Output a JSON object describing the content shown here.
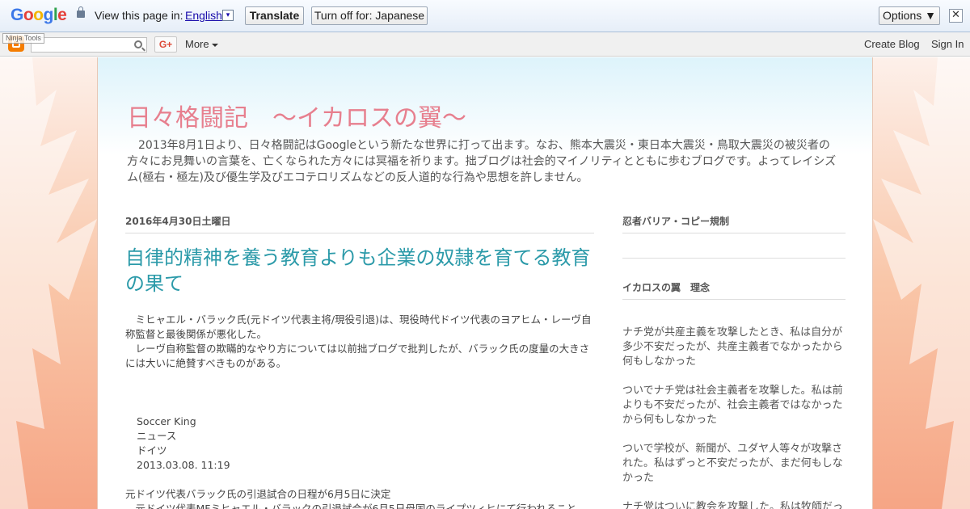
{
  "translate_bar": {
    "logo": "Google",
    "prompt": "View this page in:",
    "language": "English",
    "dropdown_glyph": "▾",
    "translate_label": "Translate",
    "turn_off_label": "Turn off for: Japanese",
    "options_label": "Options ▼",
    "close_glyph": "✕"
  },
  "navbar": {
    "ninja_label": "Ninja Tools",
    "search_placeholder": "",
    "gplus_label": "G+",
    "more_label": "More",
    "create_blog": "Create Blog",
    "sign_in": "Sign In"
  },
  "blog": {
    "title": "日々格闘記　～イカロスの翼～",
    "description": "　2013年8月1日より、日々格闘記はGoogleという新たな世界に打って出ます。なお、熊本大震災・東日本大震災・鳥取大震災の被災者の方々にお見舞いの言葉を、亡くなられた方々には冥福を祈ります。拙ブログは社会的マイノリティとともに歩むブログです。よってレイシズム(極右・極左)及び優生学及びエコテロリズムなどの反人道的な行為や思想を許しません。"
  },
  "post": {
    "date": "2016年4月30日土曜日",
    "title": "自律的精神を養う教育よりも企業の奴隷を育てる教育の果て",
    "para1": "　ミヒャエル・バラック氏(元ドイツ代表主将/現役引退)は、現役時代ドイツ代表のヨアヒム・レーヴ自称監督と最後関係が悪化した。",
    "para2": "　レーヴ自称監督の欺瞞的なやり方については以前拙ブログで批判したが、バラック氏の度量の大きさには大いに絶賛すべきものがある。",
    "source_lines": [
      "Soccer King",
      "ニュース",
      "ドイツ",
      "2013.03.08. 11:19"
    ],
    "headline": "元ドイツ代表バラック氏の引退試合の日程が6月5日に決定",
    "cut_line": "　元ドイツ代表MFミヒャエル・バラックの引退試合が6月5日母国のライプツィヒにて行われること"
  },
  "sidebar": {
    "widget1_title": "忍者バリア・コピー規制",
    "widget2_title": "イカロスの翼　理念",
    "paragraphs": [
      "ナチ党が共産主義を攻撃したとき、私は自分が多少不安だったが、共産主義者でなかったから何もしなかった",
      "ついでナチ党は社会主義者を攻撃した。私は前よりも不安だったが、社会主義者ではなかったから何もしなかった",
      "ついで学校が、新聞が、ユダヤ人等々が攻撃された。私はずっと不安だったが、まだ何もしなかった",
      "ナチ党はついに教会を攻撃した。私は牧師だっ"
    ]
  }
}
